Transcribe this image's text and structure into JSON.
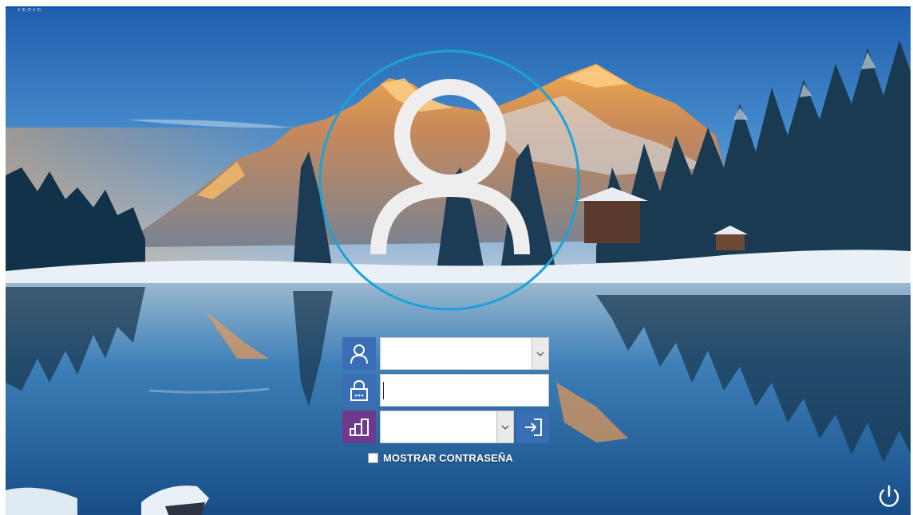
{
  "window": {
    "title": "TESTE"
  },
  "login": {
    "user_field": {
      "value": "",
      "icon": "user-icon"
    },
    "password_field": {
      "value": "",
      "icon": "lock-icon"
    },
    "company_field": {
      "value": "",
      "icon": "building-icon"
    },
    "enter_button": {
      "icon": "sign-in-icon"
    },
    "show_password": {
      "label": "MOSTRAR CONTRASEÑA",
      "checked": false
    }
  },
  "system": {
    "power_icon": "power-icon"
  },
  "colors": {
    "accent_blue": "#3a6eb4",
    "accent_purple": "#6f3a8e",
    "avatar_ring": "#1aa3d8"
  }
}
